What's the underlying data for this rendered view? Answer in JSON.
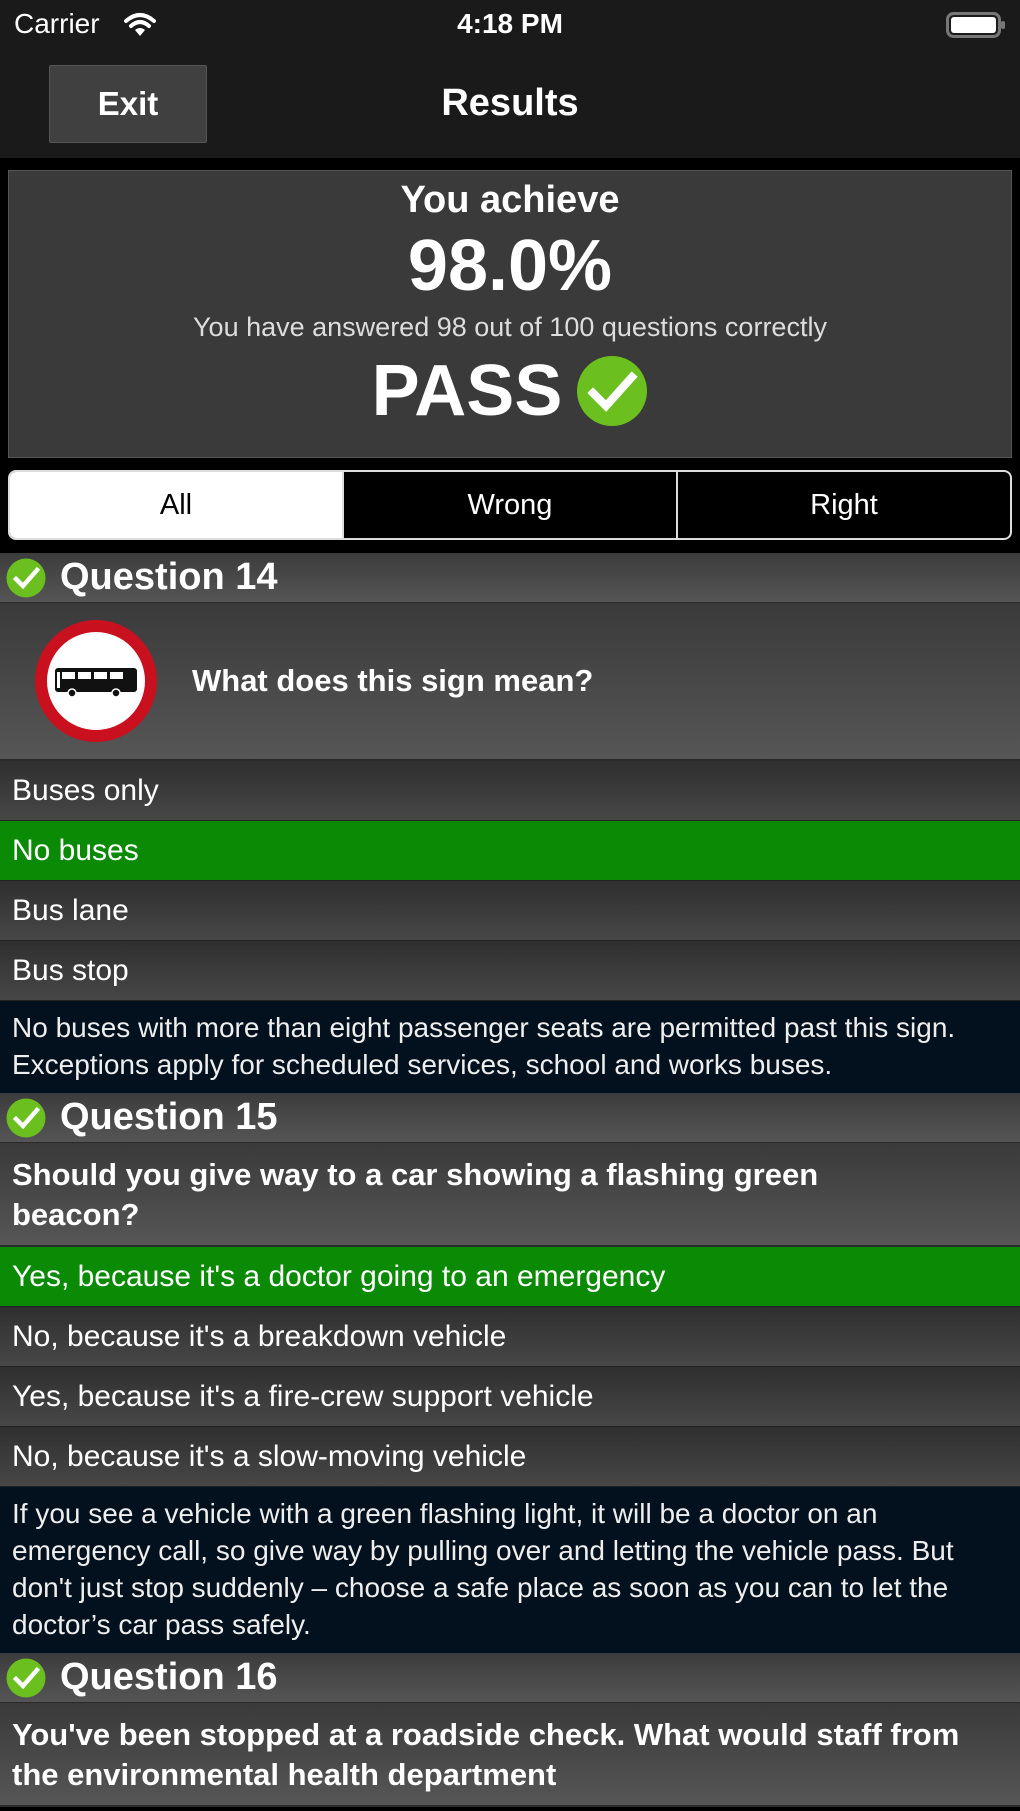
{
  "status_bar": {
    "carrier": "Carrier",
    "time": "4:18 PM",
    "wifi_icon": "wifi-icon",
    "battery_icon": "battery-icon"
  },
  "nav": {
    "exit_label": "Exit",
    "title": "Results"
  },
  "summary": {
    "heading": "You achieve",
    "percent": "98.0%",
    "detail": "You have answered 98 out of 100 questions correctly",
    "correct": 98,
    "total": 100,
    "result": "PASS",
    "result_icon": "check-circle-icon"
  },
  "filter": {
    "segments": [
      {
        "label": "All",
        "active": true
      },
      {
        "label": "Wrong",
        "active": false
      },
      {
        "label": "Right",
        "active": false
      }
    ]
  },
  "questions": [
    {
      "title": "Question 14",
      "status": "correct",
      "image": "no-buses-sign-icon",
      "text": "What does this sign mean?",
      "answers": [
        {
          "text": "Buses only",
          "correct": false
        },
        {
          "text": "No buses",
          "correct": true
        },
        {
          "text": "Bus lane",
          "correct": false
        },
        {
          "text": "Bus stop",
          "correct": false
        }
      ],
      "explanation": "No buses with more than eight passenger seats are permitted past this sign. Exceptions apply for scheduled services, school and works buses."
    },
    {
      "title": "Question 15",
      "status": "correct",
      "text": "Should you give way to a car showing a flashing green beacon?",
      "answers": [
        {
          "text": "Yes, because it's a doctor going to an emergency",
          "correct": true
        },
        {
          "text": "No, because it's a breakdown vehicle",
          "correct": false
        },
        {
          "text": "Yes, because it's a fire-crew support vehicle",
          "correct": false
        },
        {
          "text": "No, because it's a slow-moving vehicle",
          "correct": false
        }
      ],
      "explanation": "If you see a vehicle with a green flashing light, it will be a doctor on an emergency call, so give way by pulling over and letting the vehicle pass. But don't just stop suddenly – choose a safe place as soon as you can to let the doctor’s car pass safely."
    },
    {
      "title": "Question 16",
      "status": "correct",
      "text": "You've been stopped at a roadside check. What would staff from the environmental health department"
    }
  ],
  "colors": {
    "correct_answer_bg": "#0a8a05",
    "check_green": "#6bbf1f",
    "explanation_bg": "#03111e",
    "sign_red": "#c8101e"
  }
}
